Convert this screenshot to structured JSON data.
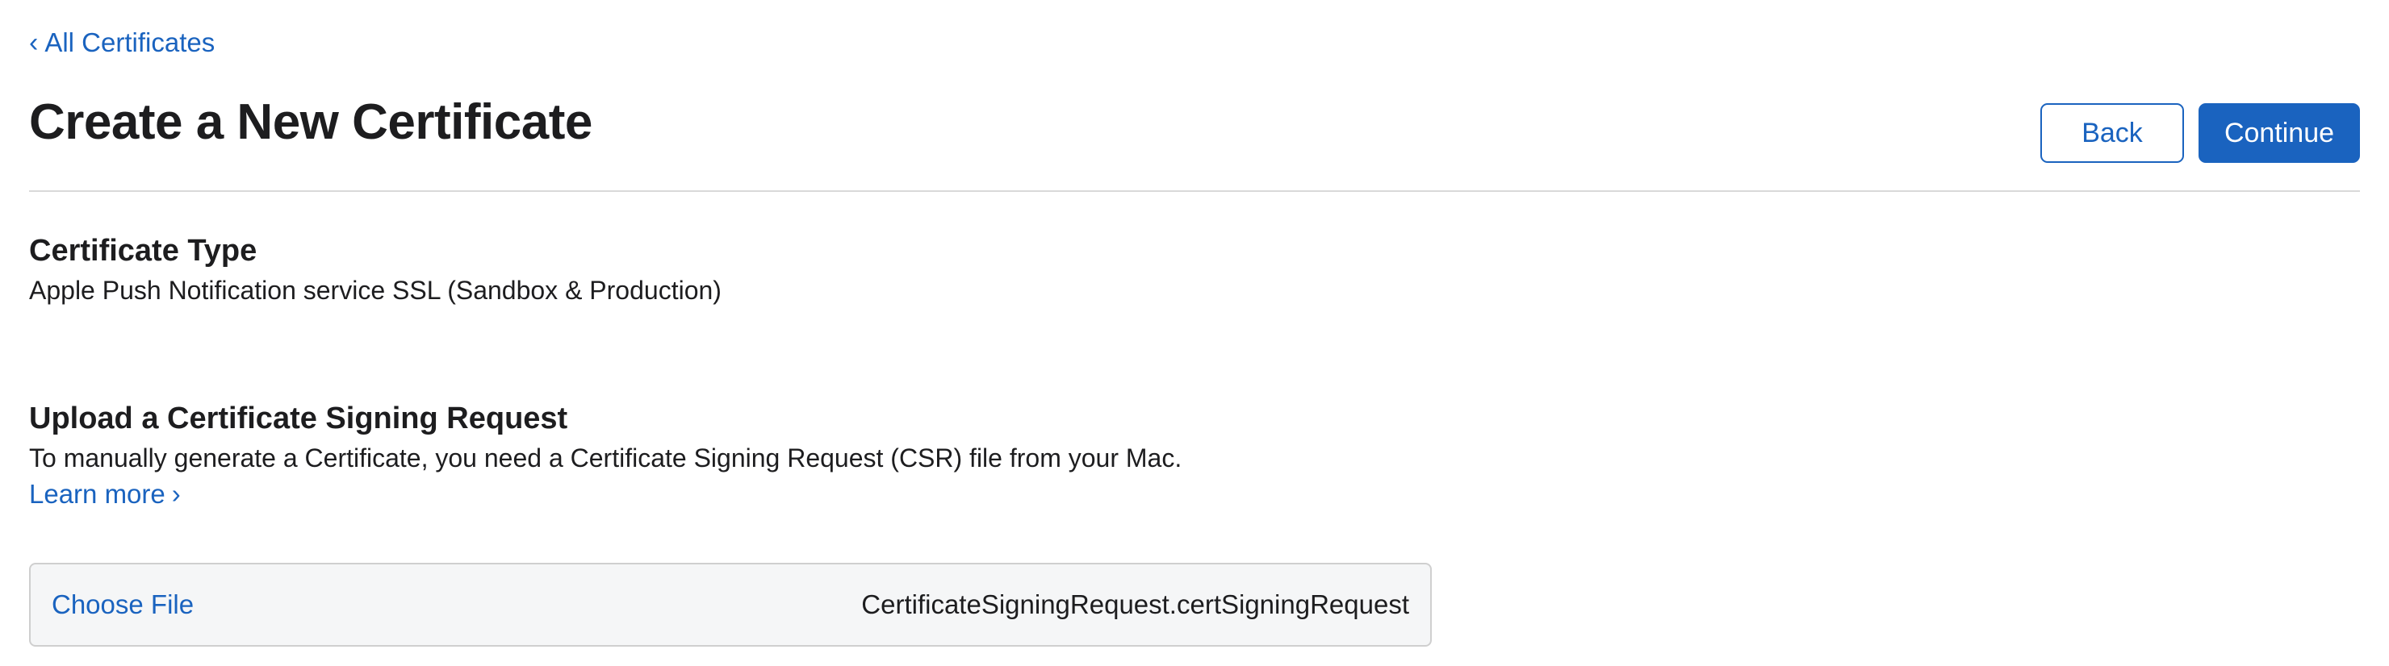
{
  "breadcrumb": {
    "chevron": "‹",
    "label": "All Certificates"
  },
  "header": {
    "title": "Create a New Certificate",
    "back_label": "Back",
    "continue_label": "Continue"
  },
  "certificate_type": {
    "heading": "Certificate Type",
    "value": "Apple Push Notification service SSL (Sandbox & Production)"
  },
  "csr_upload": {
    "heading": "Upload a Certificate Signing Request",
    "description": "To manually generate a Certificate, you need a Certificate Signing Request (CSR) file from your Mac.",
    "learn_more_label": "Learn more",
    "learn_more_chevron": "›",
    "choose_file_label": "Choose File",
    "selected_file": "CertificateSigningRequest.certSigningRequest"
  },
  "colors": {
    "accent": "#1a63bf",
    "text": "#1d1d1f",
    "divider": "#d9d9d9",
    "file_box_bg": "#f5f6f7"
  }
}
